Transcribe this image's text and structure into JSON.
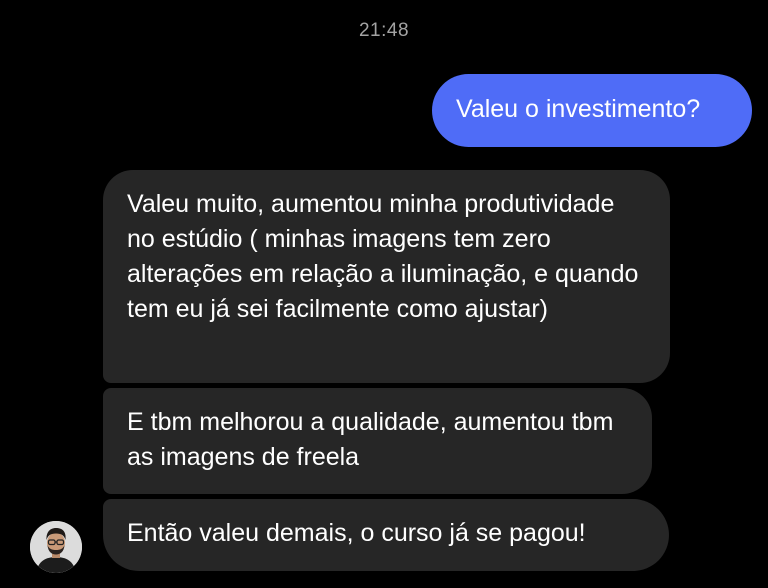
{
  "chat": {
    "timestamp": "21:48",
    "messages": [
      {
        "direction": "sent",
        "text": "Valeu o investimento?"
      },
      {
        "direction": "received",
        "text": "Valeu muito, aumentou minha produtividade no estúdio ( minhas imagens tem zero alterações em relação a iluminação, e quando tem eu já sei facilmente como ajustar)"
      },
      {
        "direction": "received",
        "text": "E tbm melhorou a qualidade, aumentou tbm as imagens de freela"
      },
      {
        "direction": "received",
        "text": "Então valeu demais, o curso já se pagou!"
      }
    ],
    "avatar_icon": "user-avatar-photo"
  },
  "colors": {
    "background": "#000000",
    "sent_bubble": "#4f6cf7",
    "received_bubble": "#262626",
    "timestamp_text": "#a3a3a3",
    "message_text": "#ffffff"
  }
}
